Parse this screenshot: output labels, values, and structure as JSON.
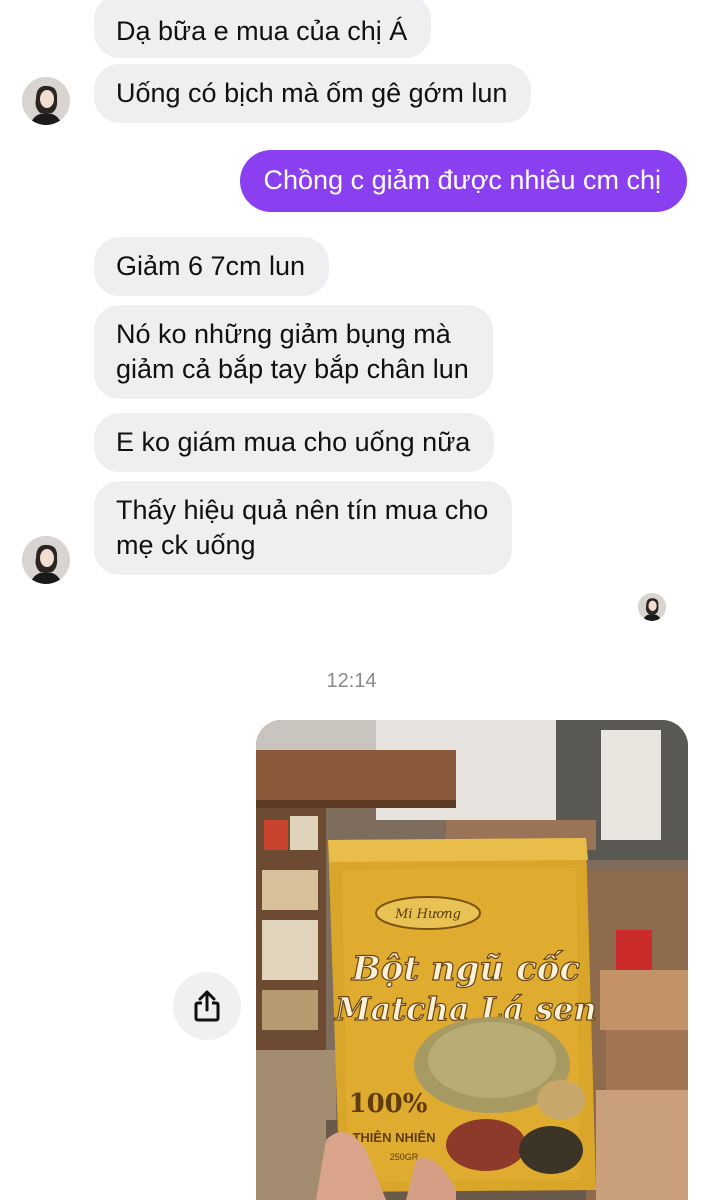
{
  "messages": {
    "incoming_1": {
      "lines": [
        "Dạ bữa e mua của chị Á"
      ]
    },
    "incoming_2": {
      "lines": [
        "Uống có bịch mà ốm gê gớm lun"
      ]
    },
    "outgoing_1": {
      "lines": [
        "Chồng c giảm được nhiêu cm chị"
      ]
    },
    "incoming_3": {
      "lines": [
        "Giảm 6 7cm lun"
      ]
    },
    "incoming_4": {
      "lines": [
        "Nó ko những giảm bụng mà",
        "giảm cả bắp tay bắp chân lun"
      ]
    },
    "incoming_5": {
      "lines": [
        "E ko giám mua cho uống nữa"
      ]
    },
    "incoming_6": {
      "lines": [
        "Thấy hiệu quả nên tín mua cho",
        "mẹ ck uống"
      ]
    }
  },
  "timestamp": "12:14",
  "product_photo": {
    "brand": "Mi Hương",
    "title_line_1": "Bột ngũ cốc",
    "title_line_2": "Matcha Lá sen",
    "badge": "100%",
    "badge_sub": "THIÊN NHIÊN",
    "weight": "250GR"
  },
  "icons": {
    "avatar": "user-avatar-icon",
    "share": "share-icon",
    "seen": "seen-avatar-icon"
  },
  "colors": {
    "outgoing_bubble": "#8a3ff0",
    "incoming_bubble": "#efeff2",
    "timestamp": "#8a8a8e",
    "product_gold": "#d9a62a"
  }
}
